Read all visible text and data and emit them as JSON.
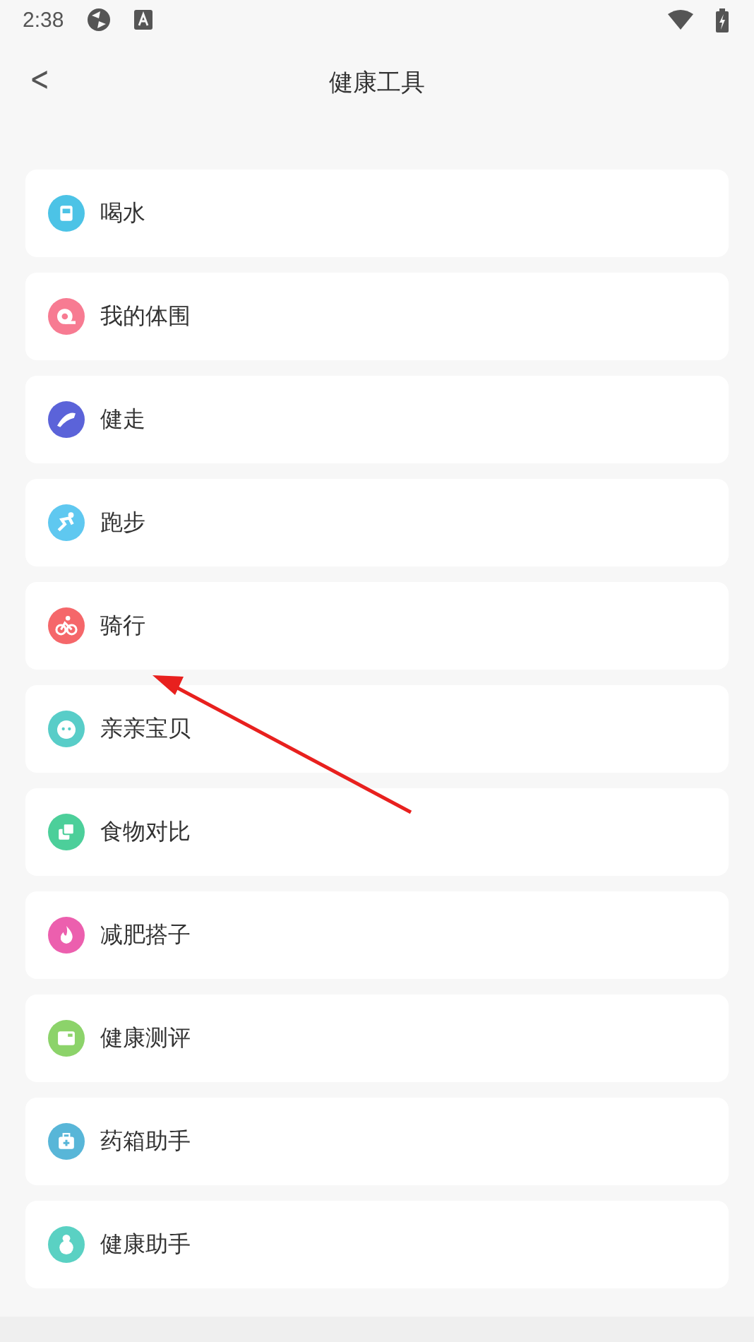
{
  "status_bar": {
    "time": "2:38"
  },
  "header": {
    "back": "<",
    "title": "健康工具"
  },
  "items": [
    {
      "label": "喝水",
      "color": "#4cc3e6"
    },
    {
      "label": "我的体围",
      "color": "#f77b92"
    },
    {
      "label": "健走",
      "color": "#5b63d9"
    },
    {
      "label": "跑步",
      "color": "#5fc8f0"
    },
    {
      "label": "骑行",
      "color": "#f5676a"
    },
    {
      "label": "亲亲宝贝",
      "color": "#58cdc8"
    },
    {
      "label": "食物对比",
      "color": "#4ccf9a"
    },
    {
      "label": "减肥搭子",
      "color": "#ec5fae"
    },
    {
      "label": "健康测评",
      "color": "#8cd36a"
    },
    {
      "label": "药箱助手",
      "color": "#58b6d8"
    },
    {
      "label": "健康助手",
      "color": "#5ad1c3"
    }
  ]
}
